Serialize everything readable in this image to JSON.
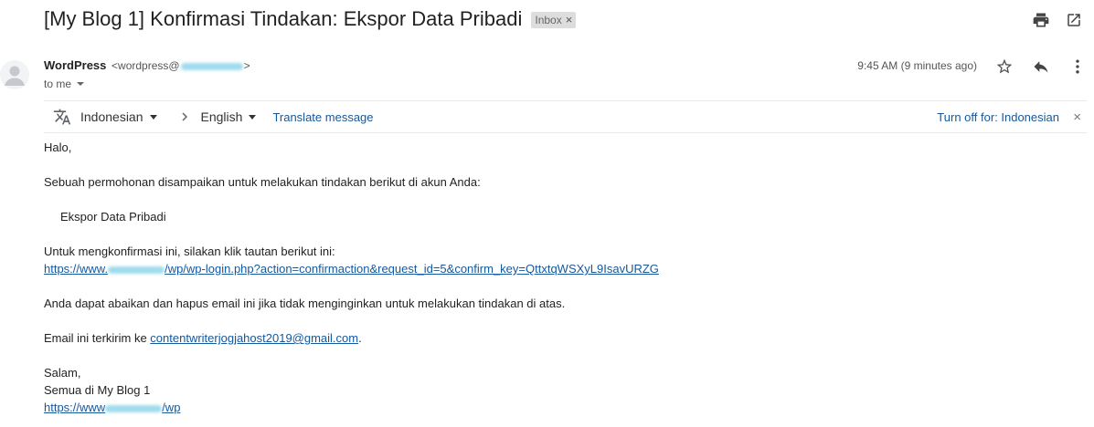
{
  "subject": {
    "title": "[My Blog 1] Konfirmasi Tindakan: Ekspor Data Pribadi",
    "label": "Inbox",
    "label_close": "×"
  },
  "top_icons": [
    "print-icon",
    "open-in-new-window-icon"
  ],
  "sender": {
    "name": "WordPress",
    "email_prefix": "<wordpress@",
    "email_suffix": ">",
    "recipient": "to me"
  },
  "message_meta": {
    "time": "9:45 AM (9 minutes ago)",
    "icons": [
      "star-icon",
      "reply-icon",
      "more-vert-icon"
    ]
  },
  "translate": {
    "from": "Indonesian",
    "to": "English",
    "translate_label": "Translate message",
    "turn_off_label": "Turn off for: Indonesian",
    "close": "×"
  },
  "body": {
    "greeting": "Halo,",
    "intro": "Sebuah permohonan disampaikan untuk melakukan tindakan berikut di akun Anda:",
    "action": "Ekspor Data Pribadi",
    "confirm_text": "Untuk mengkonfirmasi ini, silakan klik tautan berikut ini:",
    "confirm_link_prefix": "https://www.",
    "confirm_link_suffix": "/wp/wp-login.php?action=confirmaction&request_id=5&confirm_key=QttxtqWSXyL9IsavURZG",
    "ignore_text": "Anda dapat abaikan dan hapus email ini jika tidak menginginkan untuk melakukan tindakan di atas.",
    "sent_to_prefix": "Email ini terkirim ke ",
    "sent_to_email": "contentwriterjogjahost2019@gmail.com",
    "sent_to_suffix": ".",
    "closing": "Salam,",
    "signature": "Semua di My Blog 1",
    "site_link_prefix": "https://www",
    "site_link_suffix": "/wp"
  },
  "colors": {
    "link": "#15589c",
    "redaction": "#8fd6ea",
    "label_bg": "#dddddd"
  }
}
